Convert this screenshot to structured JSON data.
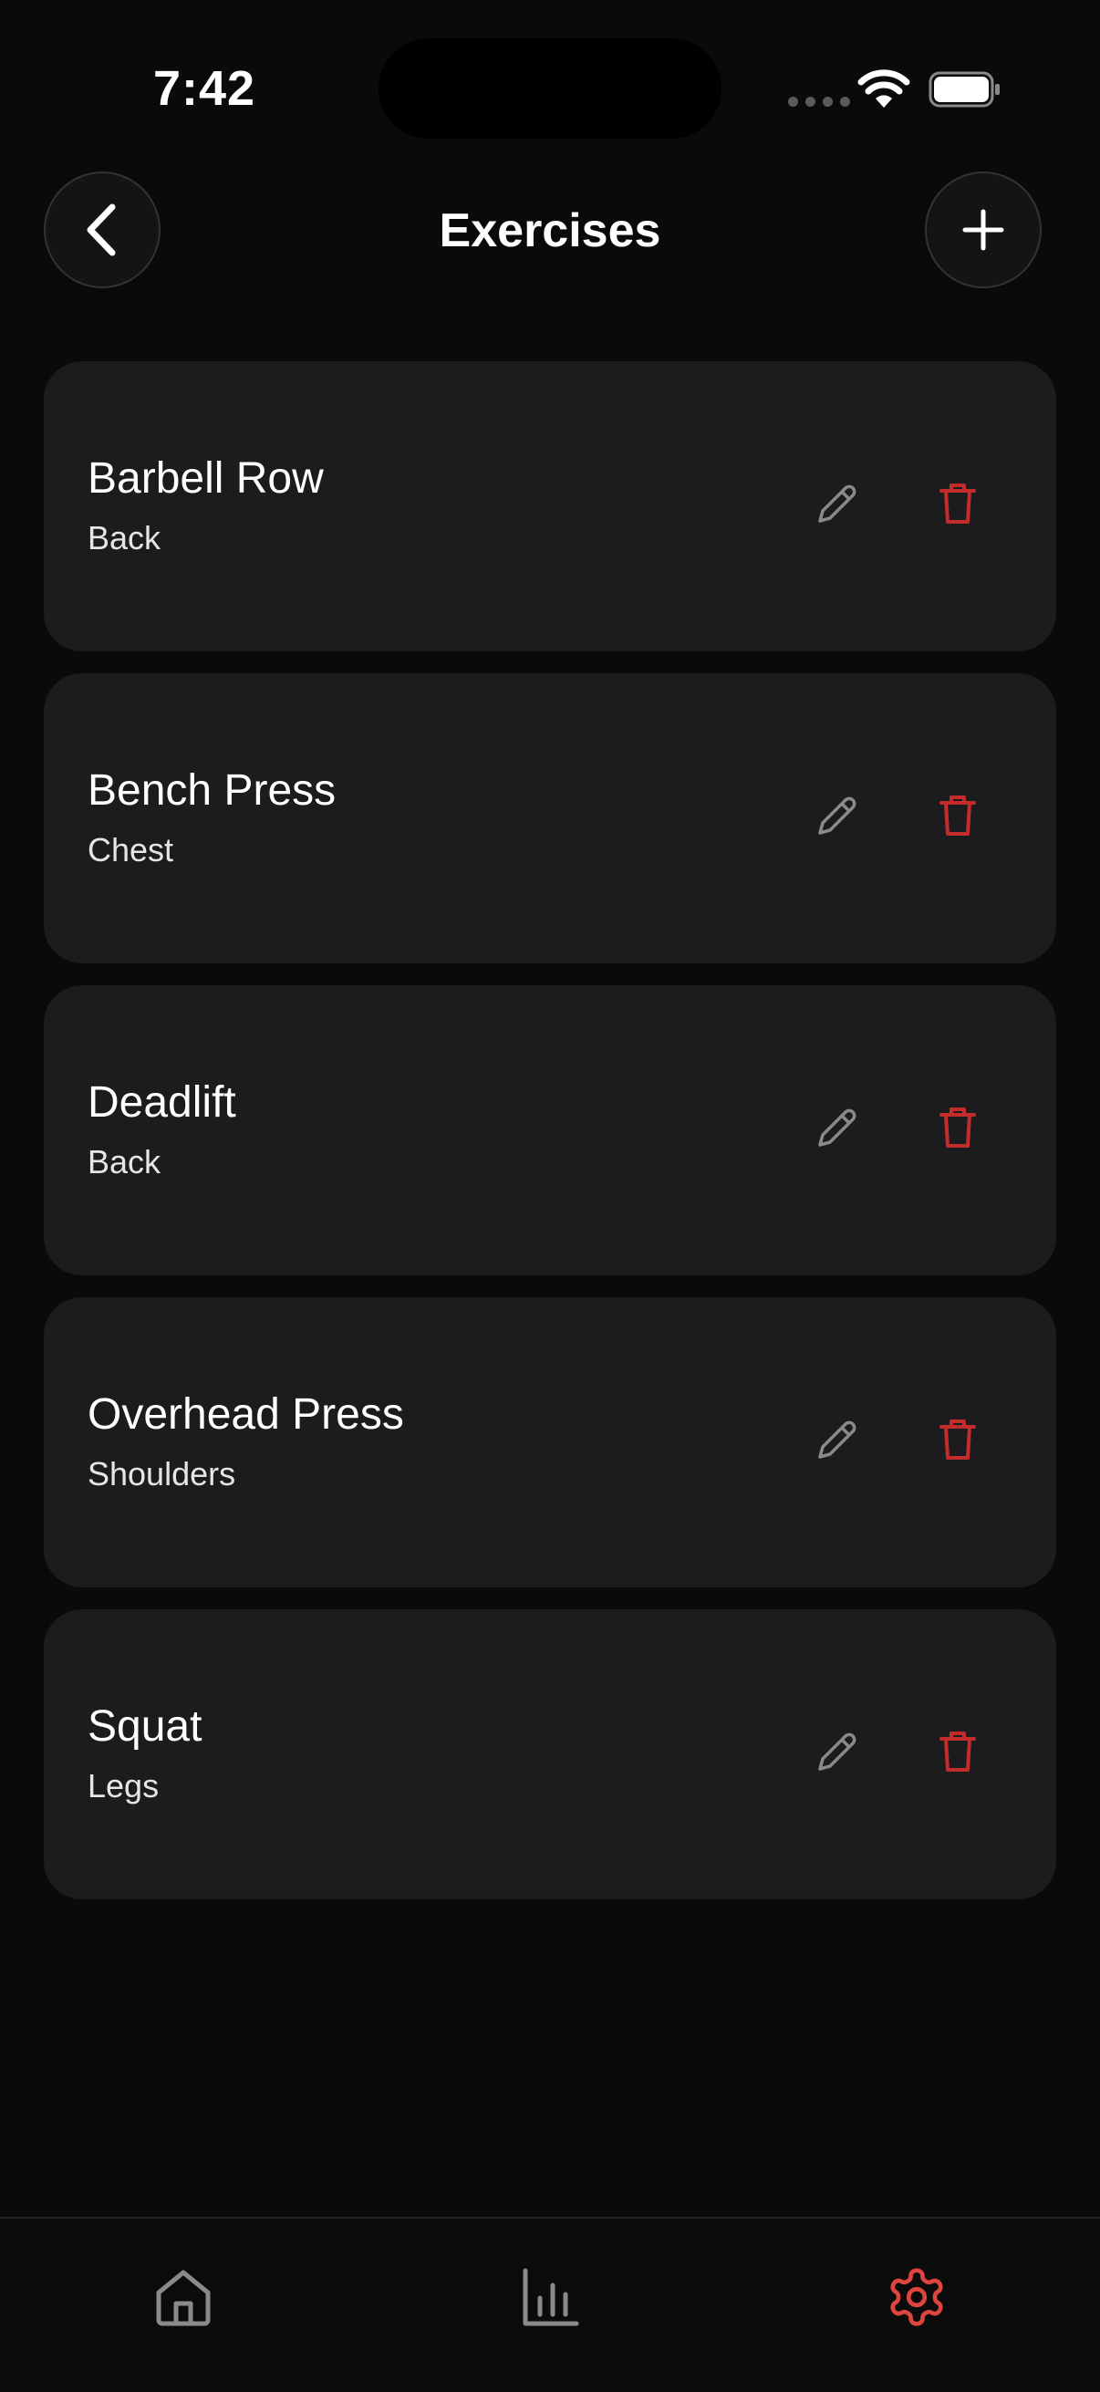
{
  "status_bar": {
    "time": "7:42",
    "icons": [
      "signal-icon",
      "wifi-icon",
      "battery-icon"
    ]
  },
  "header": {
    "title": "Exercises",
    "back_icon": "chevron-left-icon",
    "add_icon": "plus-icon"
  },
  "exercises": [
    {
      "name": "Barbell Row",
      "group": "Back"
    },
    {
      "name": "Bench Press",
      "group": "Chest"
    },
    {
      "name": "Deadlift",
      "group": "Back"
    },
    {
      "name": "Overhead Press",
      "group": "Shoulders"
    },
    {
      "name": "Squat",
      "group": "Legs"
    }
  ],
  "row_actions": {
    "edit_icon": "pencil-icon",
    "delete_icon": "trash-icon"
  },
  "tab_bar": {
    "tabs": [
      {
        "icon": "home-icon",
        "active": false
      },
      {
        "icon": "bar-chart-icon",
        "active": false
      },
      {
        "icon": "gear-icon",
        "active": true
      }
    ]
  },
  "colors": {
    "background": "#0a0a0a",
    "card": "#1c1c1e",
    "danger": "#c42b2b",
    "accent": "#e0443e",
    "muted_icon": "#8a8a8a"
  }
}
